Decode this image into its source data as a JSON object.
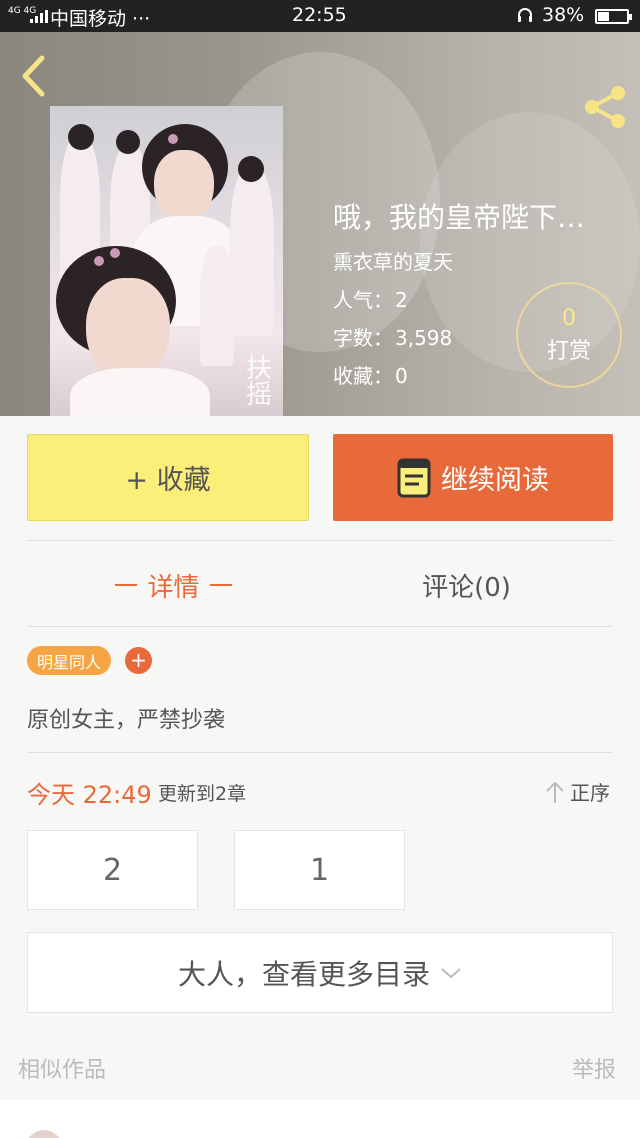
{
  "status_bar": {
    "network": "4G 4G",
    "carrier": "中国移动 ···",
    "time": "22:55",
    "battery_percent": "38%",
    "battery_level": 0.38
  },
  "header": {
    "back_icon": "chevron-left-icon",
    "share_icon": "share-icon"
  },
  "book": {
    "title": "哦，我的皇帝陛下…",
    "author": "熏衣草的夏天",
    "cover_stamp": "扶摇",
    "stats": [
      {
        "key": "人气：",
        "value": "2"
      },
      {
        "key": "字数：",
        "value": "3,598"
      },
      {
        "key": "收藏：",
        "value": "0"
      }
    ],
    "reward": {
      "count": "0",
      "label": "打赏"
    }
  },
  "actions": {
    "favorite_label": "+ 收藏",
    "read_label": "继续阅读",
    "read_icon": "book-icon"
  },
  "tabs": [
    {
      "label": "详情",
      "active": true
    },
    {
      "label": "评论(0)",
      "active": false
    }
  ],
  "detail": {
    "tag": "明星同人",
    "tag_add": "+",
    "description": "原创女主，严禁抄袭"
  },
  "update": {
    "day": "今天 22:49",
    "text": "更新到2章",
    "sort_label": "正序",
    "sort_icon": "arrow-up-icon"
  },
  "chapters": [
    "2",
    "1"
  ],
  "more_catalog": {
    "label": "大人，查看更多目录",
    "icon": "chevron-down-icon"
  },
  "footer": {
    "similar": "相似作品",
    "report": "举报"
  },
  "colors": {
    "accent": "#e8693a",
    "favorite": "#fbef7a",
    "tag": "#f5a543",
    "reward_number": "#ffe784"
  }
}
